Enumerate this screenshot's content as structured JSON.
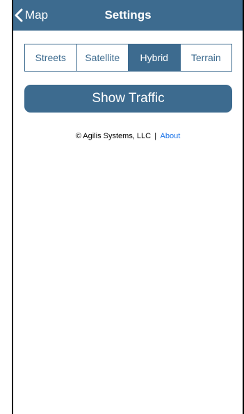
{
  "navbar": {
    "back_label": "Map",
    "title": "Settings",
    "back_icon": "chevron-left-icon"
  },
  "map_type": {
    "options": [
      "Streets",
      "Satellite",
      "Hybrid",
      "Terrain"
    ],
    "selected": "Hybrid"
  },
  "traffic_button": {
    "label": "Show Traffic"
  },
  "footer": {
    "copyright": "© Agilis Systems, LLC",
    "separator": "|",
    "about_label": "About"
  },
  "colors": {
    "accent": "#3d6b8f",
    "background": "#ffffff",
    "link": "#1a73e8"
  }
}
